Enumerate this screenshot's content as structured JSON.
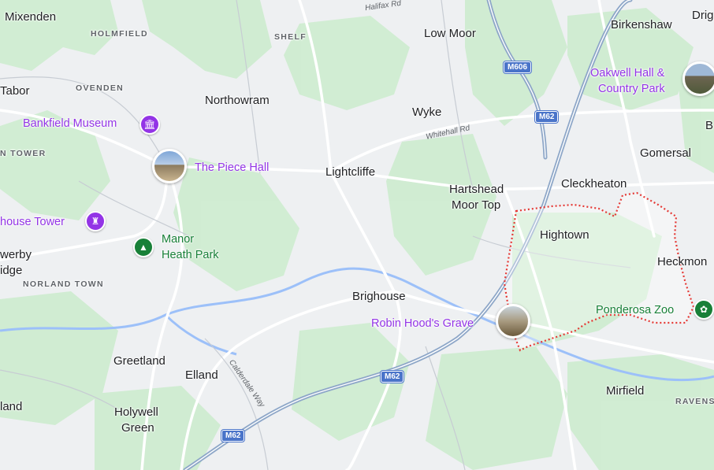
{
  "map": {
    "colors": {
      "land": "#eef0f2",
      "green": "#cdeccf",
      "water": "#9cc0f9",
      "road": "#ffffff",
      "motorway": "#8ea7c8",
      "boundary": "#e53935",
      "poi_purple": "#9334e6",
      "poi_green": "#188038"
    },
    "labels": {
      "mixenden": "Mixenden",
      "holmfield": "HOLMFIELD",
      "shelf": "SHELF",
      "halifax_rd": "Halifax Rd",
      "low_moor": "Low Moor",
      "birkenshaw": "Birkenshaw",
      "drig": "Drig",
      "tabor": "Tabor",
      "ovenden": "OVENDEN",
      "northowram": "Northowram",
      "wyke": "Wyke",
      "whitehall_rd": "Whitehall Rd",
      "bankfield_museum": "Bankfield Museum",
      "n_tower": "N TOWER",
      "piece_hall": "The Piece Hall",
      "lightcliffe": "Lightcliffe",
      "hartshead_1": "Hartshead",
      "hartshead_2": "Moor Top",
      "cleckheaton": "Cleckheaton",
      "gomersal": "Gomersal",
      "b_edge": "B",
      "oakwell_1": "Oakwell Hall &",
      "oakwell_2": "Country Park",
      "hightown": "Hightown",
      "heckmon": "Heckmon",
      "house_tower": "house Tower",
      "manor_1": "Manor",
      "manor_2": "Heath Park",
      "werby": "werby",
      "idge": "idge",
      "norland_town": "NORLAND TOWN",
      "brighouse": "Brighouse",
      "robin_hood": "Robin Hood's Grave",
      "ponderosa_zoo": "Ponderosa Zoo",
      "greetland": "Greetland",
      "elland": "Elland",
      "calderdale_way": "Calderdale Way",
      "mirfield": "Mirfield",
      "ravens": "RAVENS",
      "land": "land",
      "holywell_1": "Holywell",
      "holywell_2": "Green"
    },
    "shields": {
      "m606": "M606",
      "m62_a": "M62",
      "m62_b": "M62",
      "m62_c": "M62"
    },
    "icons": {
      "museum": "museum-icon",
      "tower": "castle-icon",
      "park": "tree-icon",
      "zoo": "paw-icon",
      "piece_hall_photo": "photo-thumbnail-icon",
      "oakwell_photo": "photo-thumbnail-icon",
      "robin_photo": "photo-thumbnail-icon"
    }
  }
}
